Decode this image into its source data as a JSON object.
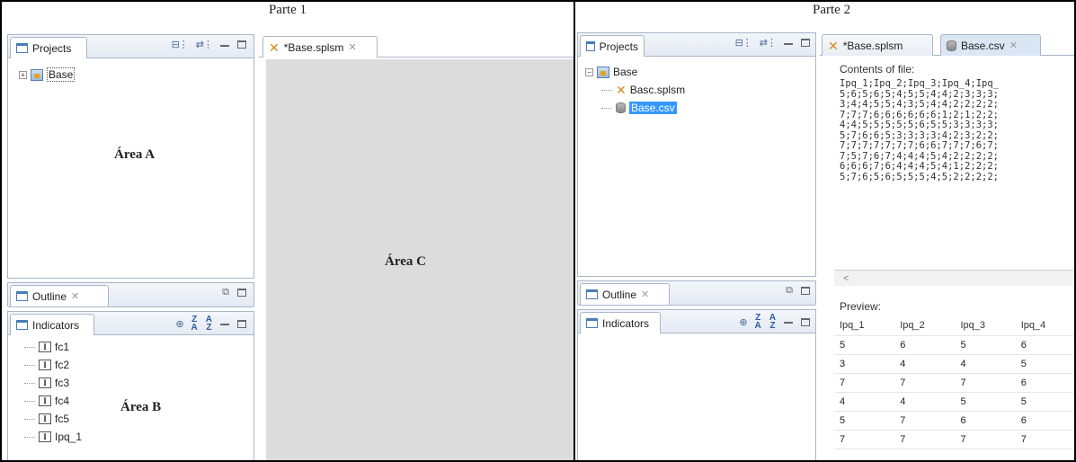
{
  "part1": {
    "title": "Parte 1",
    "projects_tab": "Projects",
    "editor_tab": "*Base.splsm",
    "tree": [
      {
        "label": "Base"
      }
    ],
    "area_a": "Área A",
    "area_b": "Área B",
    "area_c": "Área C",
    "outline_tab": "Outline",
    "indicators_tab": "Indicators",
    "indicators": [
      "fc1",
      "fc2",
      "fc3",
      "fc4",
      "fc5",
      "Ipq_1"
    ]
  },
  "part2": {
    "title": "Parte 2",
    "projects_tab": "Projects",
    "editor_tabs": [
      "*Base.splsm",
      "Base.csv"
    ],
    "tree": {
      "root": "Base",
      "children": [
        "Basc.splsm",
        "Base.csv"
      ]
    },
    "outline_tab": "Outline",
    "indicators_tab": "Indicators",
    "contents_label": "Contents of file:",
    "csv_lines": [
      "Ipq_1;Ipq_2;Ipq_3;Ipq_4;Ipq_",
      "5;6;5;6;5;4;5;5;4;4;2;3;3;3;",
      "3;4;4;5;5;4;3;5;4;4;2;2;2;2;",
      "7;7;7;6;6;6;6;6;6;1;2;1;2;2;",
      "4;4;5;5;5;5;5;6;5;5;3;3;3;3;",
      "5;7;6;6;5;3;3;3;3;4;2;3;2;2;",
      "7;7;7;7;7;7;7;6;6;7;7;7;6;7;",
      "7;5;7;6;7;4;4;4;5;4;2;2;2;2;",
      "6;6;6;7;6;4;4;4;5;4;1;2;2;2;",
      "5;7;6;5;6;5;5;5;4;5;2;2;2;2;"
    ],
    "scroll_left": "<",
    "preview_label": "Preview:",
    "preview_columns": [
      "Ipq_1",
      "Ipq_2",
      "Ipq_3",
      "Ipq_4"
    ],
    "preview_rows": [
      [
        "5",
        "6",
        "5",
        "6"
      ],
      [
        "3",
        "4",
        "4",
        "5"
      ],
      [
        "7",
        "7",
        "7",
        "6"
      ],
      [
        "4",
        "4",
        "5",
        "5"
      ],
      [
        "5",
        "7",
        "6",
        "6"
      ],
      [
        "7",
        "7",
        "7",
        "7"
      ]
    ]
  }
}
